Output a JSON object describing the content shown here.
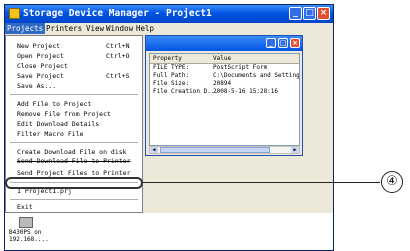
{
  "window": {
    "title": "Storage Device Manager - Project1",
    "controls": [
      "_",
      "□",
      "×"
    ]
  },
  "menubar": [
    "Projects",
    "Printers",
    "View",
    "Window",
    "Help"
  ],
  "dropdown": {
    "items": [
      {
        "label": "New Project",
        "shortcut": "Ctrl+N"
      },
      {
        "label": "Open Project",
        "shortcut": "Ctrl+O"
      },
      {
        "label": "Close Project",
        "shortcut": ""
      },
      {
        "label": "Save Project",
        "shortcut": "Ctrl+S"
      },
      {
        "label": "Save As...",
        "shortcut": ""
      },
      {
        "label": "Add File to Project",
        "shortcut": ""
      },
      {
        "label": "Remove File from Project",
        "shortcut": ""
      },
      {
        "label": "Edit Download Details",
        "shortcut": ""
      },
      {
        "label": "Filter Macro File",
        "shortcut": ""
      },
      {
        "label": "Create Download File on disk",
        "shortcut": ""
      },
      {
        "label": "Send Download File to Printer",
        "shortcut": ""
      },
      {
        "label": "Send Project Files to Printer",
        "shortcut": ""
      },
      {
        "label": "1 Project1.prj",
        "shortcut": ""
      },
      {
        "label": "Exit",
        "shortcut": ""
      }
    ]
  },
  "child_window": {
    "columns": [
      "Property",
      "Value"
    ],
    "rows": [
      {
        "property": "FILE TYPE:",
        "value": "PostScript Form"
      },
      {
        "property": "Full Path:",
        "value": "C:\\Documents and Settings\\Ad"
      },
      {
        "property": "File Size:",
        "value": "20894"
      },
      {
        "property": "File Creation D...",
        "value": "2008-5-16 15:28:16"
      }
    ]
  },
  "printer": {
    "label_line1": "B430PS on",
    "label_line2": "192.168...."
  },
  "callout": {
    "number": "④"
  }
}
